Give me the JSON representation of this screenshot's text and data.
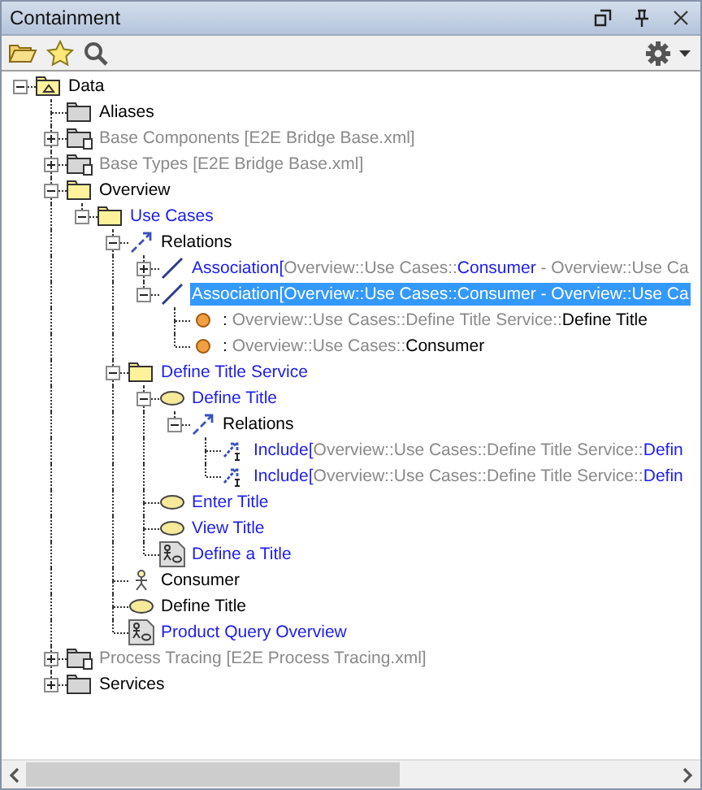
{
  "panel": {
    "title": "Containment"
  },
  "tree": [
    {
      "kind": "model",
      "parts": [
        {
          "text": "Data",
          "color": "#000000"
        }
      ],
      "expanded": true,
      "selected": false,
      "children": [
        {
          "kind": "folder",
          "parts": [
            {
              "text": "Aliases",
              "color": "#000000"
            }
          ],
          "selected": false
        },
        {
          "kind": "shared-package",
          "parts": [
            {
              "text": "Base Components [E2E Bridge Base.xml]",
              "color": "#8a8a8a"
            }
          ],
          "expanded": false,
          "selected": false
        },
        {
          "kind": "shared-package",
          "parts": [
            {
              "text": "Base Types [E2E Bridge Base.xml]",
              "color": "#8a8a8a"
            }
          ],
          "expanded": false,
          "selected": false
        },
        {
          "kind": "package",
          "parts": [
            {
              "text": "Overview",
              "color": "#000000"
            }
          ],
          "expanded": true,
          "selected": false,
          "children": [
            {
              "kind": "package",
              "parts": [
                {
                  "text": "Use Cases",
                  "color": "#1c1cf0"
                }
              ],
              "expanded": true,
              "selected": false,
              "children": [
                {
                  "kind": "relations",
                  "parts": [
                    {
                      "text": "Relations",
                      "color": "#000000"
                    }
                  ],
                  "expanded": true,
                  "selected": false,
                  "children": [
                    {
                      "kind": "association",
                      "parts": [
                        {
                          "text": "Association[",
                          "color": "#1c1cf0"
                        },
                        {
                          "text": "Overview::Use Cases::",
                          "color": "#8a8a8a"
                        },
                        {
                          "text": "Consumer",
                          "color": "#1c1cf0"
                        },
                        {
                          "text": " - Overview::Use Ca",
                          "color": "#8a8a8a"
                        }
                      ],
                      "expanded": false,
                      "selected": false
                    },
                    {
                      "kind": "association",
                      "parts": [
                        {
                          "text": "Association[",
                          "color": "#ffffff"
                        },
                        {
                          "text": "Overview::Use Cases::",
                          "color": "#ffffff"
                        },
                        {
                          "text": "Consumer",
                          "color": "#ffffff"
                        },
                        {
                          "text": " - Overview::Use Ca",
                          "color": "#ffffff"
                        }
                      ],
                      "expanded": true,
                      "selected": true,
                      "children": [
                        {
                          "kind": "property",
                          "parts": [
                            {
                              "text": ": ",
                              "color": "#000000"
                            },
                            {
                              "text": "Overview::Use Cases::Define Title Service::",
                              "color": "#8a8a8a"
                            },
                            {
                              "text": "Define Title",
                              "color": "#000000"
                            }
                          ],
                          "selected": false
                        },
                        {
                          "kind": "property",
                          "parts": [
                            {
                              "text": ": ",
                              "color": "#000000"
                            },
                            {
                              "text": "Overview::Use Cases::",
                              "color": "#8a8a8a"
                            },
                            {
                              "text": "Consumer",
                              "color": "#000000"
                            }
                          ],
                          "selected": false
                        }
                      ]
                    }
                  ]
                },
                {
                  "kind": "package",
                  "parts": [
                    {
                      "text": "Define Title Service",
                      "color": "#1c1cf0"
                    }
                  ],
                  "expanded": true,
                  "selected": false,
                  "children": [
                    {
                      "kind": "use-case",
                      "parts": [
                        {
                          "text": "Define Title",
                          "color": "#1c1cf0"
                        }
                      ],
                      "expanded": true,
                      "selected": false,
                      "children": [
                        {
                          "kind": "relations",
                          "parts": [
                            {
                              "text": "Relations",
                              "color": "#000000"
                            }
                          ],
                          "expanded": true,
                          "selected": false,
                          "children": [
                            {
                              "kind": "include",
                              "parts": [
                                {
                                  "text": "Include[",
                                  "color": "#1c1cf0"
                                },
                                {
                                  "text": "Overview::Use Cases::Define Title Service::",
                                  "color": "#8a8a8a"
                                },
                                {
                                  "text": "Defin",
                                  "color": "#1c1cf0"
                                }
                              ],
                              "selected": false
                            },
                            {
                              "kind": "include",
                              "parts": [
                                {
                                  "text": "Include[",
                                  "color": "#1c1cf0"
                                },
                                {
                                  "text": "Overview::Use Cases::Define Title Service::",
                                  "color": "#8a8a8a"
                                },
                                {
                                  "text": "Defin",
                                  "color": "#1c1cf0"
                                }
                              ],
                              "selected": false
                            }
                          ]
                        }
                      ]
                    },
                    {
                      "kind": "use-case",
                      "parts": [
                        {
                          "text": "Enter Title",
                          "color": "#1c1cf0"
                        }
                      ],
                      "selected": false
                    },
                    {
                      "kind": "use-case",
                      "parts": [
                        {
                          "text": "View Title",
                          "color": "#1c1cf0"
                        }
                      ],
                      "selected": false
                    },
                    {
                      "kind": "diagram",
                      "parts": [
                        {
                          "text": "Define a Title",
                          "color": "#1c1cf0"
                        }
                      ],
                      "selected": false
                    }
                  ]
                },
                {
                  "kind": "actor",
                  "parts": [
                    {
                      "text": "Consumer",
                      "color": "#000000"
                    }
                  ],
                  "selected": false
                },
                {
                  "kind": "use-case",
                  "parts": [
                    {
                      "text": "Define Title",
                      "color": "#000000"
                    }
                  ],
                  "selected": false
                },
                {
                  "kind": "diagram",
                  "parts": [
                    {
                      "text": "Product Query Overview",
                      "color": "#1c1cf0"
                    }
                  ],
                  "selected": false
                }
              ]
            }
          ]
        },
        {
          "kind": "shared-package",
          "parts": [
            {
              "text": "Process Tracing [E2E Process Tracing.xml]",
              "color": "#8a8a8a"
            }
          ],
          "expanded": false,
          "selected": false
        },
        {
          "kind": "folder",
          "parts": [
            {
              "text": "Services",
              "color": "#000000"
            }
          ],
          "expanded": false,
          "selected": false
        }
      ]
    }
  ]
}
